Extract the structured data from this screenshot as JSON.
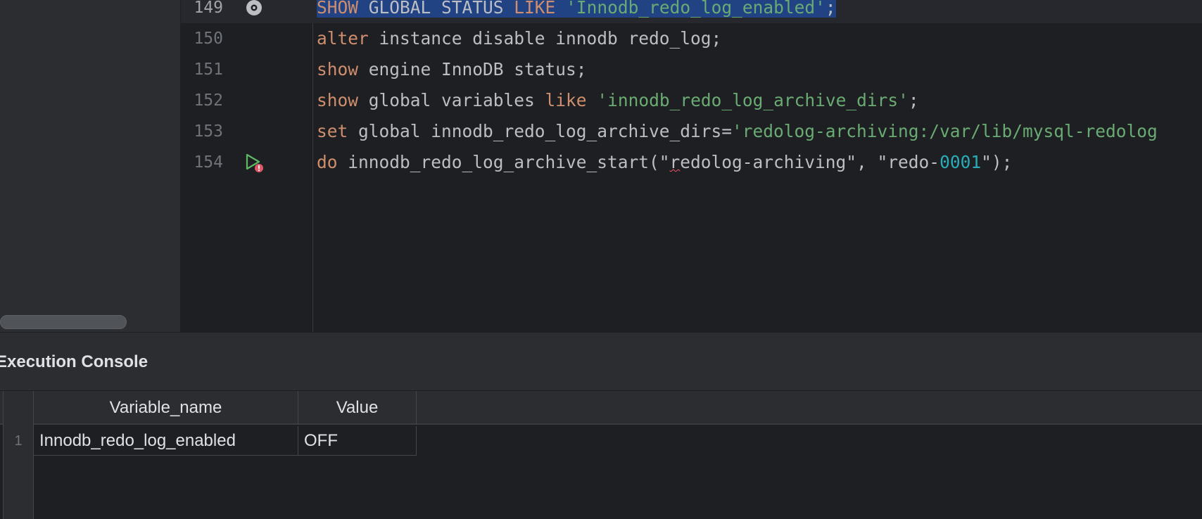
{
  "editor": {
    "lines": [
      {
        "number": "149",
        "tokens": [
          {
            "t": "SHOW",
            "c": "kw"
          },
          {
            "t": " GLOBAL STATUS ",
            "c": ""
          },
          {
            "t": "LIKE",
            "c": "kw"
          },
          {
            "t": " ",
            "c": ""
          },
          {
            "t": "'Innodb_redo_log_enabled'",
            "c": "str"
          },
          {
            "t": ";",
            "c": ""
          }
        ],
        "selected": true,
        "current": true,
        "gutter_icon": "gear-icon"
      },
      {
        "number": "150",
        "tokens": [
          {
            "t": "alter",
            "c": "kw"
          },
          {
            "t": " instance disable innodb redo_log;",
            "c": ""
          }
        ]
      },
      {
        "number": "151",
        "tokens": [
          {
            "t": "show",
            "c": "kw"
          },
          {
            "t": " engine InnoDB status;",
            "c": ""
          }
        ]
      },
      {
        "number": "152",
        "tokens": [
          {
            "t": "show",
            "c": "kw"
          },
          {
            "t": " global variables ",
            "c": ""
          },
          {
            "t": "like",
            "c": "kw"
          },
          {
            "t": " ",
            "c": ""
          },
          {
            "t": "'innodb_redo_log_archive_dirs'",
            "c": "str"
          },
          {
            "t": ";",
            "c": ""
          }
        ]
      },
      {
        "number": "153",
        "tokens": [
          {
            "t": "set",
            "c": "kw"
          },
          {
            "t": " global innodb_redo_log_archive_dirs=",
            "c": ""
          },
          {
            "t": "'redolog-archiving:/var/lib/mysql-redolog",
            "c": "str"
          }
        ]
      },
      {
        "number": "154",
        "tokens": [
          {
            "t": "do",
            "c": "kw"
          },
          {
            "t": " innodb_redo_log_archive_start(\"",
            "c": ""
          },
          {
            "t": "r",
            "c": "squiggle"
          },
          {
            "t": "edolog-archiving\", \"redo-",
            "c": ""
          },
          {
            "t": "0001",
            "c": "num"
          },
          {
            "t": "\");",
            "c": ""
          }
        ],
        "gutter_icon": "run-error-icon"
      }
    ]
  },
  "console": {
    "title": "Execution Console",
    "columns": [
      "Variable_name",
      "Value"
    ],
    "rows": [
      {
        "num": "1",
        "cells": [
          "Innodb_redo_log_enabled",
          "OFF"
        ]
      }
    ]
  }
}
